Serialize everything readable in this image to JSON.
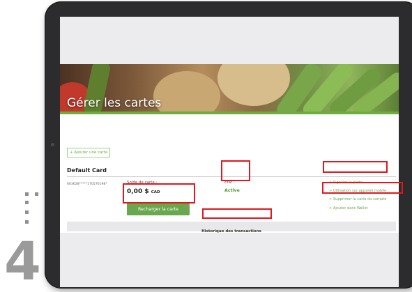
{
  "step": {
    "number": "4"
  },
  "banner": {
    "title": "Gérer les cartes"
  },
  "page": {
    "add_card_label": "+ Ajouter une carte",
    "card_name": "Default Card",
    "card_number": "603628*****170576198*",
    "balance_label": "Solde de carte :",
    "balance_amount": "0,00 $",
    "balance_currency": "CAD",
    "recharge_label": "Recharger la carte",
    "status_label": "État :",
    "status_value": "Active",
    "actions": [
      {
        "label": "> Signaler la perte",
        "highlighted": true
      },
      {
        "label": "> Utilisation sur appareil mobile",
        "highlighted": false
      },
      {
        "label": "> Supprimer la carte du compte",
        "highlighted": true
      },
      {
        "label": "> Ajouter dans Wallet",
        "highlighted": false
      }
    ],
    "history_label": "Historique des transactions"
  },
  "colors": {
    "accent_green": "#6aa84f",
    "highlight_red": "#e3161b",
    "device_frame": "#2c2c2e"
  }
}
